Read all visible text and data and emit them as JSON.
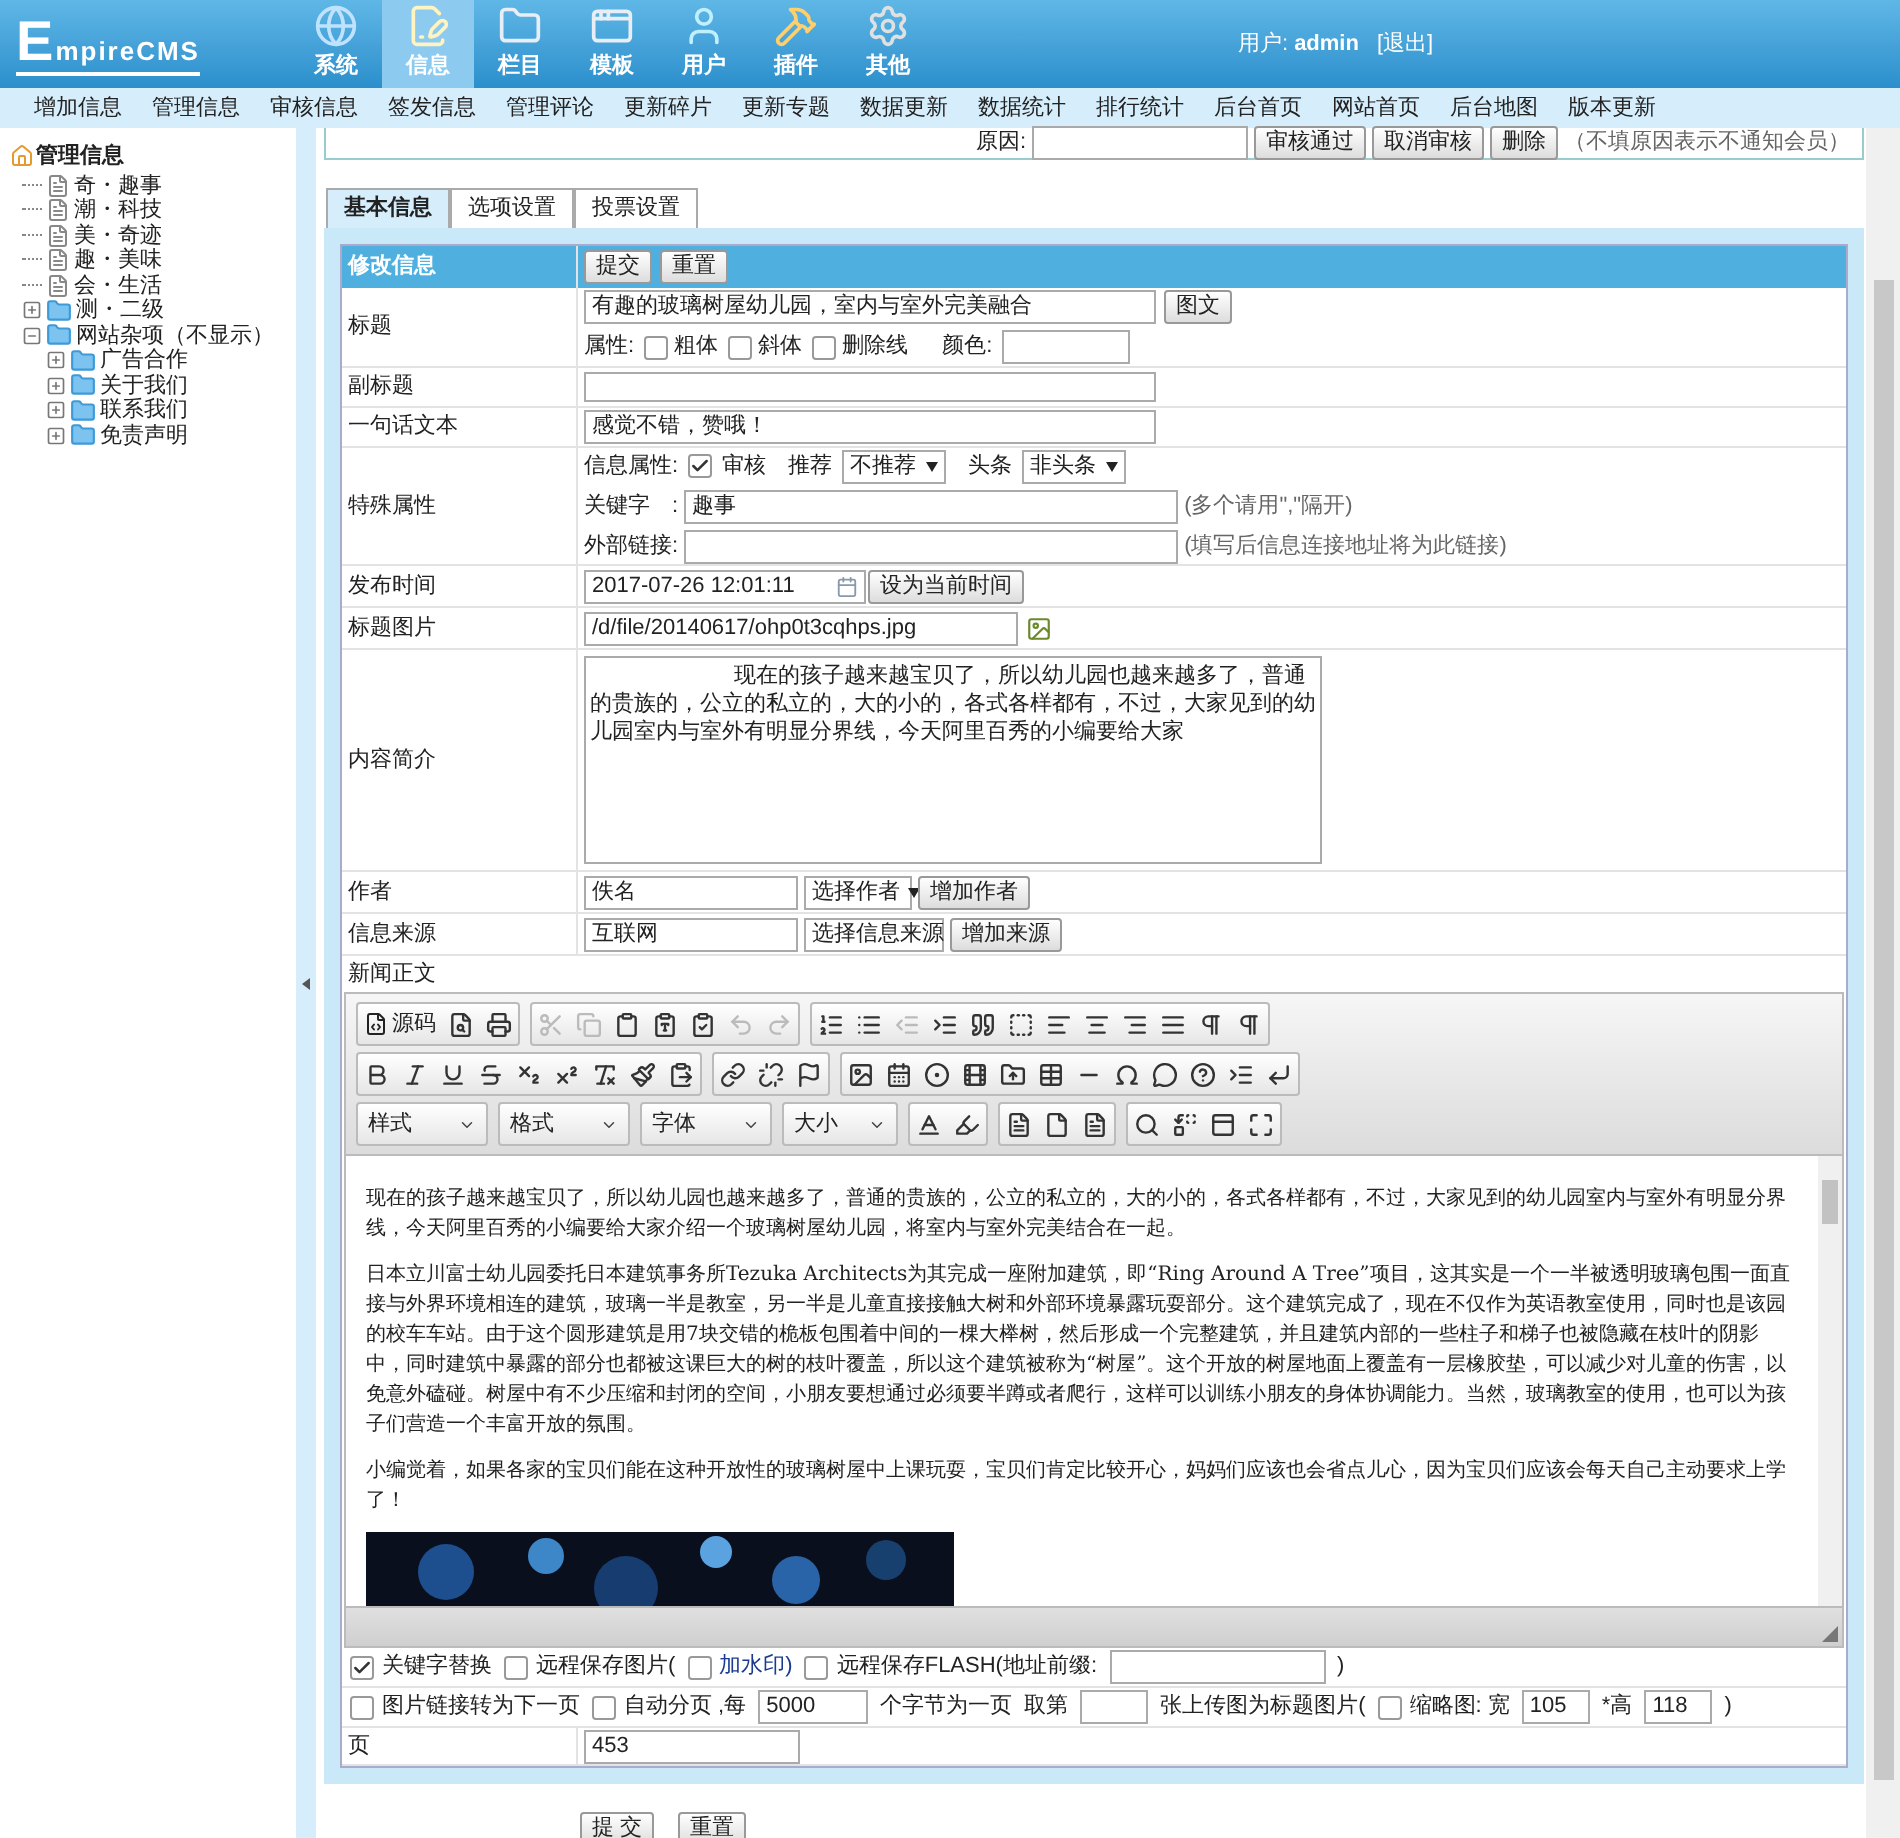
{
  "header": {
    "logo": "EmpireCMS",
    "nav": [
      {
        "label": "系统",
        "selected": false
      },
      {
        "label": "信息",
        "selected": true
      },
      {
        "label": "栏目",
        "selected": false
      },
      {
        "label": "模板",
        "selected": false
      },
      {
        "label": "用户",
        "selected": false
      },
      {
        "label": "插件",
        "selected": false
      },
      {
        "label": "其他",
        "selected": false
      }
    ],
    "user_label": "用户:",
    "user_name": "admin",
    "logout": "[退出]"
  },
  "menu": [
    "增加信息",
    "管理信息",
    "审核信息",
    "签发信息",
    "管理评论",
    "更新碎片",
    "更新专题",
    "数据更新",
    "数据统计",
    "排行统计",
    "后台首页",
    "网站首页",
    "后台地图",
    "版本更新"
  ],
  "sidebar": {
    "root": "管理信息",
    "children": [
      {
        "label": "奇・趣事",
        "kind": "page"
      },
      {
        "label": "潮・科技",
        "kind": "page"
      },
      {
        "label": "美・奇迹",
        "kind": "page"
      },
      {
        "label": "趣・美味",
        "kind": "page"
      },
      {
        "label": "会・生活",
        "kind": "page"
      },
      {
        "label": "测・二级",
        "kind": "folder",
        "expanded": false
      },
      {
        "label": "网站杂项（不显示）",
        "kind": "folder",
        "expanded": true,
        "children": [
          {
            "label": "广告合作",
            "kind": "folder",
            "expanded": false
          },
          {
            "label": "关于我们",
            "kind": "folder",
            "expanded": false
          },
          {
            "label": "联系我们",
            "kind": "folder",
            "expanded": false
          },
          {
            "label": "免责声明",
            "kind": "folder",
            "expanded": false
          }
        ]
      }
    ]
  },
  "review": {
    "label": "原因:",
    "buttons": [
      "审核通过",
      "取消审核",
      "删除"
    ],
    "note": "（不填原因表示不通知会员）"
  },
  "tabs": [
    {
      "label": "基本信息",
      "selected": true
    },
    {
      "label": "选项设置",
      "selected": false
    },
    {
      "label": "投票设置",
      "selected": false
    }
  ],
  "form": {
    "heading": "修改信息",
    "buttons": [
      "提交",
      "重置"
    ],
    "title": {
      "label": "标题",
      "value": "有趣的玻璃树屋幼儿园，室内与室外完美融合",
      "button": "图文",
      "attr_label": "属性:",
      "attrs": [
        {
          "label": "粗体",
          "checked": false
        },
        {
          "label": "斜体",
          "checked": false
        },
        {
          "label": "删除线",
          "checked": false
        }
      ],
      "color_label": "颜色:"
    },
    "subtitle": {
      "label": "副标题"
    },
    "summary_line": {
      "label": "一句话文本",
      "value": "感觉不错，赞哦！"
    },
    "special": {
      "label": "特殊属性",
      "info_label": "信息属性:",
      "review": {
        "label": "审核",
        "checked": true
      },
      "recommend_label": "推荐",
      "recommend": "不推荐",
      "headline_label": "头条",
      "headline": "非头条",
      "keyword_label": "关键字　:",
      "keyword": "趣事",
      "keyword_hint": "(多个请用\",\"隔开)",
      "link_label": "外部链接:",
      "link_hint": "(填写后信息连接地址将为此链接)"
    },
    "date": {
      "label": "发布时间",
      "value": "2017-07-26 12:01:11",
      "button": "设为当前时间"
    },
    "image": {
      "label": "标题图片",
      "value": "/d/file/20140617/ohp0t3cqhps.jpg"
    },
    "intro": {
      "label": "内容简介",
      "value": "现在的孩子越来越宝贝了，所以幼儿园也越来越多了，普通的贵族的，公立的私立的，大的小的，各式各样都有，不过，大家见到的幼儿园室内与室外有明显分界线，今天阿里百秀的小编要给大家"
    },
    "author": {
      "label": "作者",
      "value": "佚名",
      "select": "选择作者",
      "button": "增加作者"
    },
    "source": {
      "label": "信息来源",
      "value": "互联网",
      "select": "选择信息来源",
      "button": "增加来源"
    },
    "body_label": "新闻正文",
    "editor": {
      "source_button": "源码",
      "combos": [
        "样式",
        "格式",
        "字体",
        "大小"
      ],
      "paragraphs": [
        "现在的孩子越来越宝贝了，所以幼儿园也越来越多了，普通的贵族的，公立的私立的，大的小的，各式各样都有，不过，大家见到的幼儿园室内与室外有明显分界线，今天阿里百秀的小编要给大家介绍一个玻璃树屋幼儿园，将室内与室外完美结合在一起。",
        "日本立川富士幼儿园委托日本建筑事务所Tezuka Architects为其完成一座附加建筑，即“Ring Around A Tree”项目，这其实是一个一半被透明玻璃包围一面直接与外界环境相连的建筑，玻璃一半是教室，另一半是儿童直接接触大树和外部环境暴露玩耍部分。这个建筑完成了，现在不仅作为英语教室使用，同时也是该园的校车车站。由于这个圆形建筑是用7块交错的桅板包围着中间的一棵大榉树，然后形成一个完整建筑，并且建筑内部的一些柱子和梯子也被隐藏在枝叶的阴影中，同时建筑中暴露的部分也都被这课巨大的树的枝叶覆盖，所以这个建筑被称为“树屋”。这个开放的树屋地面上覆盖有一层橡胶垫，可以减少对儿童的伤害，以免意外磕碰。树屋中有不少压缩和封闭的空间，小朋友要想通过必须要半蹲或者爬行，这样可以训练小朋友的身体协调能力。当然，玻璃教室的使用，也可以为孩子们营造一个丰富开放的氛围。",
        "小编觉着，如果各家的宝贝们能在这种开放性的玻璃树屋中上课玩耍，宝贝们肯定比较开心，妈妈们应该也会省点儿心，因为宝贝们应该会每天自己主动要求上学了！"
      ]
    },
    "options": [
      [
        {
          "kind": "checkbox",
          "label": "关键字替换",
          "checked": true
        },
        {
          "kind": "checkbox",
          "label": "远程保存图片(",
          "checked": false
        },
        {
          "kind": "link_checkbox",
          "label": "加水印)",
          "checked": false
        },
        {
          "kind": "checkbox",
          "label": "远程保存FLASH(地址前缀:",
          "checked": false
        },
        {
          "kind": "wide_input"
        },
        {
          "kind": "text",
          "text": ")"
        }
      ],
      [
        {
          "kind": "checkbox",
          "label": "图片链接转为下一页",
          "checked": false
        },
        {
          "kind": "checkbox",
          "label": "自动分页 ,每",
          "checked": false
        },
        {
          "kind": "input",
          "value": "5000"
        },
        {
          "kind": "text",
          "text": "个字节为一页"
        },
        {
          "kind": "text",
          "text": "取第"
        },
        {
          "kind": "short_input"
        },
        {
          "kind": "text",
          "text": "张上传图为标题图片("
        },
        {
          "kind": "checkbox",
          "label": "缩略图: 宽",
          "checked": false
        },
        {
          "kind": "short_input",
          "value": "105"
        },
        {
          "kind": "text",
          "text": "*高"
        },
        {
          "kind": "short_input",
          "value": "118"
        },
        {
          "kind": "text",
          "text": ")"
        }
      ]
    ],
    "page": {
      "label": "页",
      "value": "453"
    },
    "submit": [
      "提 交",
      "重置"
    ]
  }
}
